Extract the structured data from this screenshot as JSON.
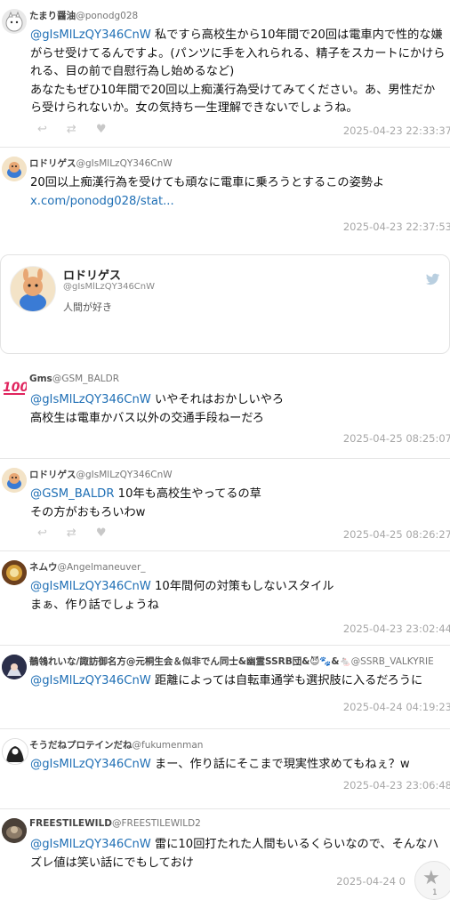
{
  "tweets": [
    {
      "name": "たまり醤油",
      "handle": "@ponodg028",
      "mention": "@gIsMlLzQY346CnW",
      "text": " 私ですら高校生から10年間で20回は電車内で性的な嫌がらせ受けてるんですよ。(パンツに手を入れられる、精子をスカートにかけられる、目の前で自慰行為し始めるなど)\nあなたもぜひ10年間で20回以上痴漢行為受けてみてください。あ、男性だから受けられないか。女の気持ち一生理解できないでしょうね。",
      "time": "2025-04-23 22:33:37"
    },
    {
      "name": "ロドリゲス",
      "handle": "@gIsMlLzQY346CnW",
      "text": "20回以上痴漢行為を受けても頑なに電車に乗ろうとするこの姿勢よ",
      "link": "x.com/ponodg028/stat...",
      "time": "2025-04-23 22:37:53"
    },
    {
      "name": "Gms",
      "handle": "@GSM_BALDR",
      "mention": "@gIsMlLzQY346CnW",
      "text": " いやそれはおかしいやろ\n高校生は電車かバス以外の交通手段ねーだろ",
      "time": "2025-04-25 08:25:07"
    },
    {
      "name": "ロドリゲス",
      "handle": "@gIsMlLzQY346CnW",
      "mention": "@GSM_BALDR",
      "text": " 10年も高校生やってるの草\nその方がおもろいわw",
      "time": "2025-04-25 08:26:27"
    },
    {
      "name": "ネムウ",
      "handle": "@Angelmaneuver_",
      "mention": "@gIsMlLzQY346CnW",
      "text": " 10年間何の対策もしないスタイル\nまぁ、作り話でしょうね",
      "time": "2025-04-23 23:02:44"
    },
    {
      "name": "鶺鴒れいな/諏訪御名方@元桐生会＆似非でん同士&幽霊SSRB団&😈🐾&🐁",
      "handle": "@SSRB_VALKYRIE",
      "mention": "@gIsMlLzQY346CnW",
      "text": " 距離によっては自転車通学も選択肢に入るだろうに",
      "time": "2025-04-24 04:19:23"
    },
    {
      "name": "そうだねプロテインだね",
      "handle": "@fukumenman",
      "mention": "@gIsMlLzQY346CnW",
      "text": " まー、作り話にそこまで現実性求めてもねぇ？w",
      "time": "2025-04-23 23:06:48"
    },
    {
      "name": "FREESTILEWILD",
      "handle": "@FREESTILEWILD2",
      "mention": "@gIsMlLzQY346CnW",
      "text": " 雷に10回打たれた人間もいるくらいなので、そんなハズレ値は笑い話にでもしておけ",
      "time": "2025-04-24 0"
    }
  ],
  "profile_card": {
    "name": "ロドリゲス",
    "handle": "@gIsMlLzQY346CnW",
    "bio": "人間が好き"
  },
  "action_icons": [
    "reply-icon",
    "retweet-icon",
    "like-icon"
  ],
  "fab": {
    "icon": "star-icon",
    "count": "1"
  }
}
